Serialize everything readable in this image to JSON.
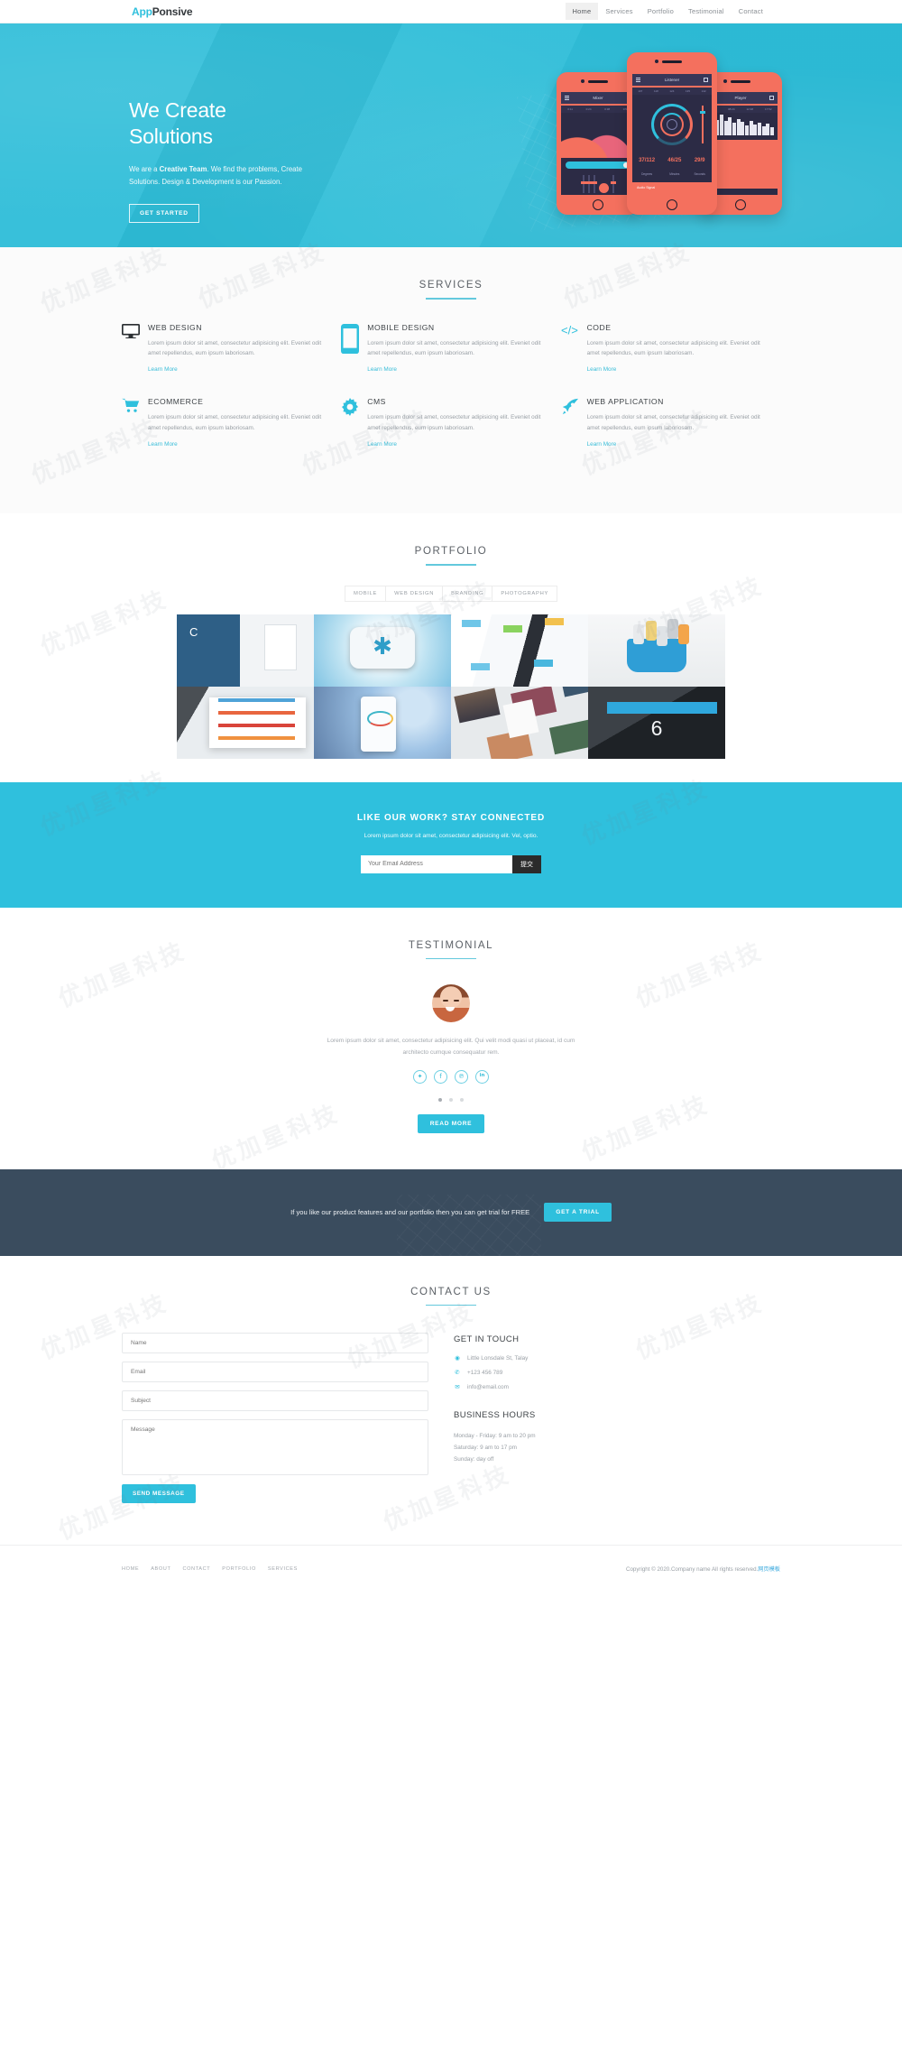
{
  "header": {
    "logo_a": "App",
    "logo_b": "Ponsive",
    "nav": [
      {
        "label": "Home",
        "active": true
      },
      {
        "label": "Services",
        "active": false
      },
      {
        "label": "Portfolio",
        "active": false
      },
      {
        "label": "Testimonial",
        "active": false
      },
      {
        "label": "Contact",
        "active": false
      }
    ]
  },
  "hero": {
    "title_line1": "We Create",
    "title_line2": "Solutions",
    "sub_pre": "We are a ",
    "sub_bold": "Creative Team",
    "sub_post": ". We find the problems, Create Solutions. Design & Development is our Passion.",
    "cta": "GET STARTED",
    "phones": [
      {
        "app": "Mixer"
      },
      {
        "app": "Listener"
      },
      {
        "app": "Player"
      }
    ],
    "phone_stats": [
      {
        "value": "37/112",
        "label": "Degrees"
      },
      {
        "value": "46/25",
        "label": "Minutes"
      },
      {
        "value": "29/9",
        "label": "Seconds"
      }
    ],
    "bg_color": "#2fc0dd"
  },
  "services": {
    "title": "SERVICES",
    "items": [
      {
        "icon": "monitor-icon",
        "title": "WEB DESIGN",
        "text": "Lorem ipsum dolor sit amet, consectetur adipisicing elit. Eveniet odit amet repellendus, eum ipsum laboriosam.",
        "link": "Learn More"
      },
      {
        "icon": "mobile-icon",
        "title": "MOBILE DESIGN",
        "text": "Lorem ipsum dolor sit amet, consectetur adipisicing elit. Eveniet odit amet repellendus, eum ipsum laboriosam.",
        "link": "Learn More"
      },
      {
        "icon": "code-icon",
        "title": "CODE",
        "text": "Lorem ipsum dolor sit amet, consectetur adipisicing elit. Eveniet odit amet repellendus, eum ipsum laboriosam.",
        "link": "Learn More"
      },
      {
        "icon": "cart-icon",
        "title": "ECOMMERCE",
        "text": "Lorem ipsum dolor sit amet, consectetur adipisicing elit. Eveniet odit amet repellendus, eum ipsum laboriosam.",
        "link": "Learn More"
      },
      {
        "icon": "gear-icon",
        "title": "CMS",
        "text": "Lorem ipsum dolor sit amet, consectetur adipisicing elit. Eveniet odit amet repellendus, eum ipsum laboriosam.",
        "link": "Learn More"
      },
      {
        "icon": "rocket-icon",
        "title": "WEB APPLICATION",
        "text": "Lorem ipsum dolor sit amet, consectetur adipisicing elit. Eveniet odit amet repellendus, eum ipsum laboriosam.",
        "link": "Learn More"
      }
    ]
  },
  "portfolio": {
    "title": "PORTFOLIO",
    "filters": [
      "MOBILE",
      "WEB DESIGN",
      "BRANDING",
      "PHOTOGRAPHY"
    ],
    "items": [
      {
        "name": "close-app-landing-page"
      },
      {
        "name": "medical-app-icon"
      },
      {
        "name": "dashboard-ui-kit"
      },
      {
        "name": "designer-toolbag-icon"
      },
      {
        "name": "tablet-project-dashboard"
      },
      {
        "name": "speed-test-mobile-app"
      },
      {
        "name": "photo-cards-collage"
      },
      {
        "name": "tablet-counter-app"
      }
    ]
  },
  "newsletter": {
    "title": "LIKE OUR WORK? STAY CONNECTED",
    "subtitle": "Lorem ipsum dolor sit amet, consectetur adipisicing elit. Vel, optio.",
    "placeholder": "Your Email Address",
    "submit": "提交"
  },
  "testimonial": {
    "title": "TESTIMONIAL",
    "quote": "Lorem ipsum dolor sit amet, consectetur adipisicing elit. Qui velit modi quasi ut placeat, id cum architecto cumque consequatur rem.",
    "socials": [
      {
        "icon": "twitter-icon",
        "glyph": "✦"
      },
      {
        "icon": "facebook-icon",
        "glyph": "f"
      },
      {
        "icon": "pinterest-icon",
        "glyph": "℗"
      },
      {
        "icon": "linkedin-icon",
        "glyph": "in"
      }
    ],
    "dots": [
      true,
      false,
      false
    ],
    "cta": "READ MORE"
  },
  "trial": {
    "text": "If you like our product features and our portfolio then you can get trial for FREE",
    "cta": "GET A TRIAL",
    "bg_color": "#3a4c5e"
  },
  "contact": {
    "title": "CONTACT US",
    "form": {
      "name_placeholder": "Name",
      "email_placeholder": "Email",
      "subject_placeholder": "Subject",
      "message_placeholder": "Message",
      "submit": "SEND MESSAGE"
    },
    "touch_title": "GET IN TOUCH",
    "address": "Little Lonsdale St, Talay",
    "phone": "+123 456 789",
    "email": "info@email.com",
    "hours_title": "BUSINESS HOURS",
    "hours": [
      "Monday - Friday: 9 am to 20 pm",
      "Saturday: 9 am to 17 pm",
      "Sunday: day off"
    ]
  },
  "footer": {
    "nav": [
      "HOME",
      "ABOUT",
      "CONTACT",
      "PORTFOLIO",
      "SERVICES"
    ],
    "copyright": "Copyright © 2020.Company name All rights reserved.",
    "copyright_cn": "网页模板"
  },
  "watermark": "优加星科技"
}
